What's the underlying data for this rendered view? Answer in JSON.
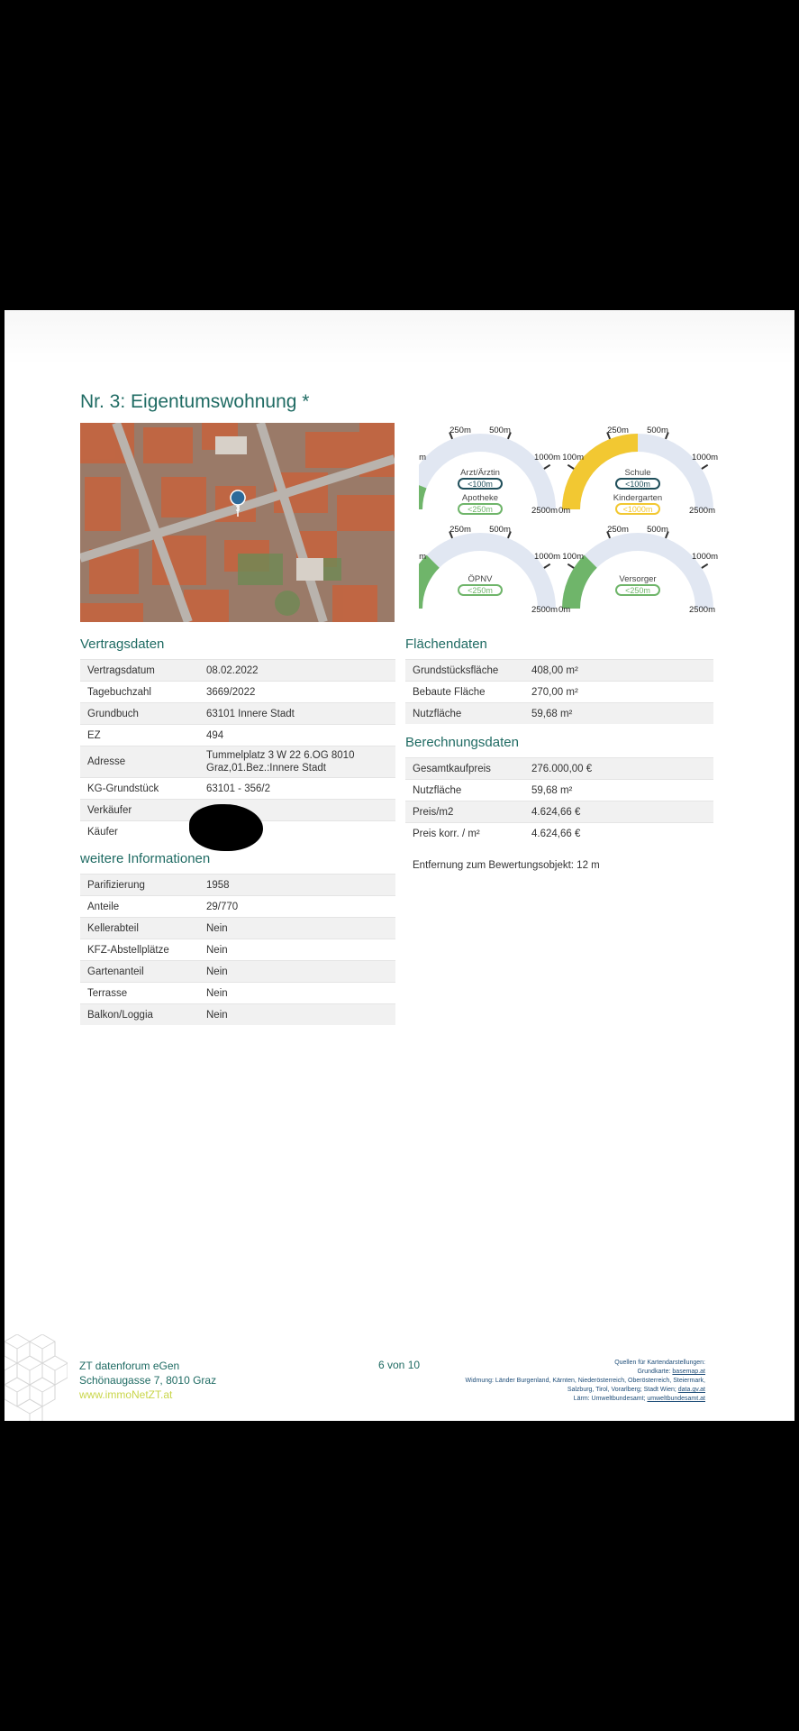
{
  "title": "Nr. 3: Eigentumswohnung *",
  "map": {
    "marker_label": "3"
  },
  "gauges": [
    {
      "labels": [
        "Arzt/Ärztin",
        "Apotheke"
      ],
      "badges": [
        "<100m",
        "<250m"
      ],
      "level": 0.12,
      "color": "#6fb56a",
      "badge_colors": [
        "#1f4e5a",
        "#6fb56a"
      ]
    },
    {
      "labels": [
        "Schule",
        "Kindergarten"
      ],
      "badges": [
        "<100m",
        "<1000m"
      ],
      "level": 0.5,
      "color": "#f2c832",
      "badge_colors": [
        "#1f4e5a",
        "#f2c832"
      ]
    },
    {
      "labels": [
        "ÖPNV"
      ],
      "badges": [
        "<250m"
      ],
      "level": 0.25,
      "color": "#6fb56a",
      "badge_colors": [
        "#6fb56a"
      ]
    },
    {
      "labels": [
        "Versorger"
      ],
      "badges": [
        "<250m"
      ],
      "level": 0.25,
      "color": "#6fb56a",
      "badge_colors": [
        "#6fb56a"
      ]
    }
  ],
  "gauge_ticks": [
    "0m",
    "100m",
    "250m",
    "500m",
    "1000m",
    "2500m"
  ],
  "vertragsdaten": {
    "heading": "Vertragsdaten",
    "rows": [
      [
        "Vertragsdatum",
        "08.02.2022"
      ],
      [
        "Tagebuchzahl",
        "3669/2022"
      ],
      [
        "Grundbuch",
        "63101 Innere Stadt"
      ],
      [
        "EZ",
        "494"
      ],
      [
        "Adresse",
        "Tummelplatz 3 W 22 6.OG 8010 Graz,01.Bez.:Innere Stadt"
      ],
      [
        "KG-Grundstück",
        "63101 - 356/2"
      ],
      [
        "Verkäufer",
        ""
      ],
      [
        "Käufer",
        ""
      ]
    ]
  },
  "weitere": {
    "heading": "weitere Informationen",
    "rows": [
      [
        "Parifizierung",
        "1958"
      ],
      [
        "Anteile",
        "29/770"
      ],
      [
        "Kellerabteil",
        "Nein"
      ],
      [
        "KFZ-Abstellplätze",
        "Nein"
      ],
      [
        "Gartenanteil",
        "Nein"
      ],
      [
        "Terrasse",
        "Nein"
      ],
      [
        "Balkon/Loggia",
        "Nein"
      ]
    ]
  },
  "flaechen": {
    "heading": "Flächendaten",
    "rows": [
      [
        "Grundstücksfläche",
        "408,00 m²"
      ],
      [
        "Bebaute Fläche",
        "270,00 m²"
      ],
      [
        "Nutzfläche",
        "59,68 m²"
      ]
    ]
  },
  "berechnung": {
    "heading": "Berechnungsdaten",
    "rows": [
      [
        "Gesamtkaufpreis",
        "276.000,00 €"
      ],
      [
        "Nutzfläche",
        "59,68 m²"
      ],
      [
        "Preis/m2",
        "4.624,66 €"
      ],
      [
        "Preis korr. / m²",
        "4.624,66 €"
      ]
    ]
  },
  "entfernung": "Entfernung zum Bewertungsobjekt: 12 m",
  "footer": {
    "company": "ZT datenforum eGen",
    "address": "Schönaugasse 7, 8010 Graz",
    "url": "www.immoNetZT.at",
    "page": "6 von 10",
    "sources": {
      "line1": "Quellen für Kartendarstellungen:",
      "line2_prefix": "Grundkarte: ",
      "line2_link": "basemap.at",
      "line3": "Widmung: Länder Burgenland, Kärnten, Niederösterreich, Oberösterreich, Steiermark,",
      "line4_prefix": "Salzburg, Tirol, Vorarlberg; Stadt Wien; ",
      "line4_link": "data.gv.at",
      "line5_prefix": "Lärm: Umweltbundesamt; ",
      "line5_link": "umweltbundesamt.at"
    }
  }
}
